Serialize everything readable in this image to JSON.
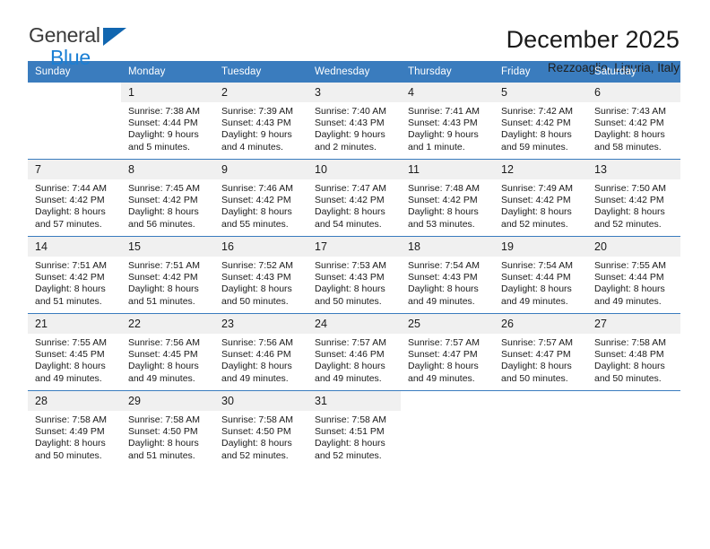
{
  "brand": {
    "name_top": "General",
    "name_bottom": "Blue",
    "accent_color": "#1b7fd4",
    "triangle_color": "#1166b0"
  },
  "header": {
    "title": "December 2025",
    "subtitle": "Rezzoaglio, Liguria, Italy"
  },
  "calendar": {
    "header_bg": "#3a7cbe",
    "daynum_bg": "#f0f0f0",
    "weekday_headers": [
      "Sunday",
      "Monday",
      "Tuesday",
      "Wednesday",
      "Thursday",
      "Friday",
      "Saturday"
    ],
    "weeks": [
      [
        {
          "day": "",
          "sunrise": "",
          "sunset": "",
          "daylight1": "",
          "daylight2": ""
        },
        {
          "day": "1",
          "sunrise": "Sunrise: 7:38 AM",
          "sunset": "Sunset: 4:44 PM",
          "daylight1": "Daylight: 9 hours",
          "daylight2": "and 5 minutes."
        },
        {
          "day": "2",
          "sunrise": "Sunrise: 7:39 AM",
          "sunset": "Sunset: 4:43 PM",
          "daylight1": "Daylight: 9 hours",
          "daylight2": "and 4 minutes."
        },
        {
          "day": "3",
          "sunrise": "Sunrise: 7:40 AM",
          "sunset": "Sunset: 4:43 PM",
          "daylight1": "Daylight: 9 hours",
          "daylight2": "and 2 minutes."
        },
        {
          "day": "4",
          "sunrise": "Sunrise: 7:41 AM",
          "sunset": "Sunset: 4:43 PM",
          "daylight1": "Daylight: 9 hours",
          "daylight2": "and 1 minute."
        },
        {
          "day": "5",
          "sunrise": "Sunrise: 7:42 AM",
          "sunset": "Sunset: 4:42 PM",
          "daylight1": "Daylight: 8 hours",
          "daylight2": "and 59 minutes."
        },
        {
          "day": "6",
          "sunrise": "Sunrise: 7:43 AM",
          "sunset": "Sunset: 4:42 PM",
          "daylight1": "Daylight: 8 hours",
          "daylight2": "and 58 minutes."
        }
      ],
      [
        {
          "day": "7",
          "sunrise": "Sunrise: 7:44 AM",
          "sunset": "Sunset: 4:42 PM",
          "daylight1": "Daylight: 8 hours",
          "daylight2": "and 57 minutes."
        },
        {
          "day": "8",
          "sunrise": "Sunrise: 7:45 AM",
          "sunset": "Sunset: 4:42 PM",
          "daylight1": "Daylight: 8 hours",
          "daylight2": "and 56 minutes."
        },
        {
          "day": "9",
          "sunrise": "Sunrise: 7:46 AM",
          "sunset": "Sunset: 4:42 PM",
          "daylight1": "Daylight: 8 hours",
          "daylight2": "and 55 minutes."
        },
        {
          "day": "10",
          "sunrise": "Sunrise: 7:47 AM",
          "sunset": "Sunset: 4:42 PM",
          "daylight1": "Daylight: 8 hours",
          "daylight2": "and 54 minutes."
        },
        {
          "day": "11",
          "sunrise": "Sunrise: 7:48 AM",
          "sunset": "Sunset: 4:42 PM",
          "daylight1": "Daylight: 8 hours",
          "daylight2": "and 53 minutes."
        },
        {
          "day": "12",
          "sunrise": "Sunrise: 7:49 AM",
          "sunset": "Sunset: 4:42 PM",
          "daylight1": "Daylight: 8 hours",
          "daylight2": "and 52 minutes."
        },
        {
          "day": "13",
          "sunrise": "Sunrise: 7:50 AM",
          "sunset": "Sunset: 4:42 PM",
          "daylight1": "Daylight: 8 hours",
          "daylight2": "and 52 minutes."
        }
      ],
      [
        {
          "day": "14",
          "sunrise": "Sunrise: 7:51 AM",
          "sunset": "Sunset: 4:42 PM",
          "daylight1": "Daylight: 8 hours",
          "daylight2": "and 51 minutes."
        },
        {
          "day": "15",
          "sunrise": "Sunrise: 7:51 AM",
          "sunset": "Sunset: 4:42 PM",
          "daylight1": "Daylight: 8 hours",
          "daylight2": "and 51 minutes."
        },
        {
          "day": "16",
          "sunrise": "Sunrise: 7:52 AM",
          "sunset": "Sunset: 4:43 PM",
          "daylight1": "Daylight: 8 hours",
          "daylight2": "and 50 minutes."
        },
        {
          "day": "17",
          "sunrise": "Sunrise: 7:53 AM",
          "sunset": "Sunset: 4:43 PM",
          "daylight1": "Daylight: 8 hours",
          "daylight2": "and 50 minutes."
        },
        {
          "day": "18",
          "sunrise": "Sunrise: 7:54 AM",
          "sunset": "Sunset: 4:43 PM",
          "daylight1": "Daylight: 8 hours",
          "daylight2": "and 49 minutes."
        },
        {
          "day": "19",
          "sunrise": "Sunrise: 7:54 AM",
          "sunset": "Sunset: 4:44 PM",
          "daylight1": "Daylight: 8 hours",
          "daylight2": "and 49 minutes."
        },
        {
          "day": "20",
          "sunrise": "Sunrise: 7:55 AM",
          "sunset": "Sunset: 4:44 PM",
          "daylight1": "Daylight: 8 hours",
          "daylight2": "and 49 minutes."
        }
      ],
      [
        {
          "day": "21",
          "sunrise": "Sunrise: 7:55 AM",
          "sunset": "Sunset: 4:45 PM",
          "daylight1": "Daylight: 8 hours",
          "daylight2": "and 49 minutes."
        },
        {
          "day": "22",
          "sunrise": "Sunrise: 7:56 AM",
          "sunset": "Sunset: 4:45 PM",
          "daylight1": "Daylight: 8 hours",
          "daylight2": "and 49 minutes."
        },
        {
          "day": "23",
          "sunrise": "Sunrise: 7:56 AM",
          "sunset": "Sunset: 4:46 PM",
          "daylight1": "Daylight: 8 hours",
          "daylight2": "and 49 minutes."
        },
        {
          "day": "24",
          "sunrise": "Sunrise: 7:57 AM",
          "sunset": "Sunset: 4:46 PM",
          "daylight1": "Daylight: 8 hours",
          "daylight2": "and 49 minutes."
        },
        {
          "day": "25",
          "sunrise": "Sunrise: 7:57 AM",
          "sunset": "Sunset: 4:47 PM",
          "daylight1": "Daylight: 8 hours",
          "daylight2": "and 49 minutes."
        },
        {
          "day": "26",
          "sunrise": "Sunrise: 7:57 AM",
          "sunset": "Sunset: 4:47 PM",
          "daylight1": "Daylight: 8 hours",
          "daylight2": "and 50 minutes."
        },
        {
          "day": "27",
          "sunrise": "Sunrise: 7:58 AM",
          "sunset": "Sunset: 4:48 PM",
          "daylight1": "Daylight: 8 hours",
          "daylight2": "and 50 minutes."
        }
      ],
      [
        {
          "day": "28",
          "sunrise": "Sunrise: 7:58 AM",
          "sunset": "Sunset: 4:49 PM",
          "daylight1": "Daylight: 8 hours",
          "daylight2": "and 50 minutes."
        },
        {
          "day": "29",
          "sunrise": "Sunrise: 7:58 AM",
          "sunset": "Sunset: 4:50 PM",
          "daylight1": "Daylight: 8 hours",
          "daylight2": "and 51 minutes."
        },
        {
          "day": "30",
          "sunrise": "Sunrise: 7:58 AM",
          "sunset": "Sunset: 4:50 PM",
          "daylight1": "Daylight: 8 hours",
          "daylight2": "and 52 minutes."
        },
        {
          "day": "31",
          "sunrise": "Sunrise: 7:58 AM",
          "sunset": "Sunset: 4:51 PM",
          "daylight1": "Daylight: 8 hours",
          "daylight2": "and 52 minutes."
        },
        {
          "day": "",
          "sunrise": "",
          "sunset": "",
          "daylight1": "",
          "daylight2": ""
        },
        {
          "day": "",
          "sunrise": "",
          "sunset": "",
          "daylight1": "",
          "daylight2": ""
        },
        {
          "day": "",
          "sunrise": "",
          "sunset": "",
          "daylight1": "",
          "daylight2": ""
        }
      ]
    ]
  }
}
